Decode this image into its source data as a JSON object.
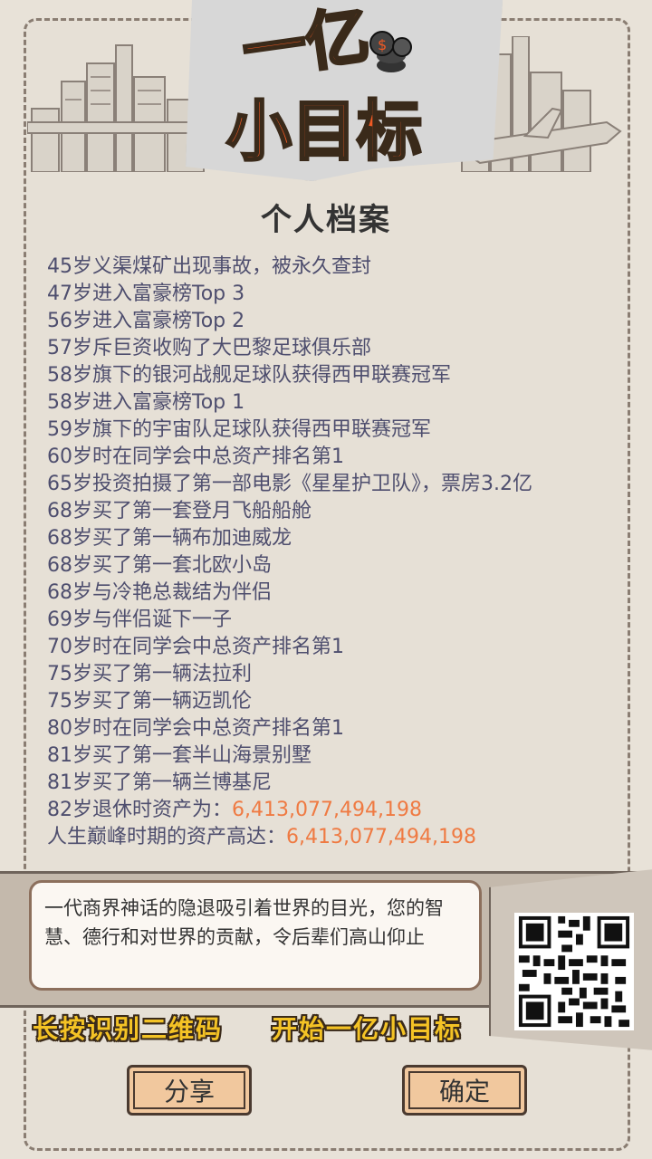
{
  "header": {
    "logo_line1": "一亿",
    "logo_line2": "小目标",
    "title": "个人档案"
  },
  "timeline": [
    "45岁义渠煤矿出现事故，被永久查封",
    "47岁进入富豪榜Top 3",
    "56岁进入富豪榜Top 2",
    "57岁斥巨资收购了大巴黎足球俱乐部",
    "58岁旗下的银河战舰足球队获得西甲联赛冠军",
    "58岁进入富豪榜Top 1",
    "59岁旗下的宇宙队足球队获得西甲联赛冠军",
    "60岁时在同学会中总资产排名第1",
    "65岁投资拍摄了第一部电影《星星护卫队》，票房3.2亿",
    "68岁买了第一套登月飞船船舱",
    "68岁买了第一辆布加迪威龙",
    "68岁买了第一套北欧小岛",
    "68岁与冷艳总裁结为伴侣",
    "69岁与伴侣诞下一子",
    "70岁时在同学会中总资产排名第1",
    "75岁买了第一辆法拉利",
    "75岁买了第一辆迈凯伦",
    "80岁时在同学会中总资产排名第1",
    "81岁买了第一套半山海景别墅",
    "81岁买了第一辆兰博基尼"
  ],
  "retire": {
    "label": "82岁退休时资产为：",
    "value": "6,413,077,494,198"
  },
  "peak": {
    "label": "人生巅峰时期的资产高达：",
    "value": "6,413,077,494,198"
  },
  "message": "一代商界神话的隐退吸引着世界的目光，您的智慧、德行和对世界的贡献，令后辈们高山仰止",
  "slogan_left": "长按识别二维码",
  "slogan_right": "开始一亿小目标",
  "buttons": {
    "share": "分享",
    "confirm": "确定"
  },
  "colors": {
    "money": "#ef7a42",
    "logo_orange": "#f15a24",
    "text_blue": "#4e4e6e",
    "button": "#f1c89e"
  }
}
